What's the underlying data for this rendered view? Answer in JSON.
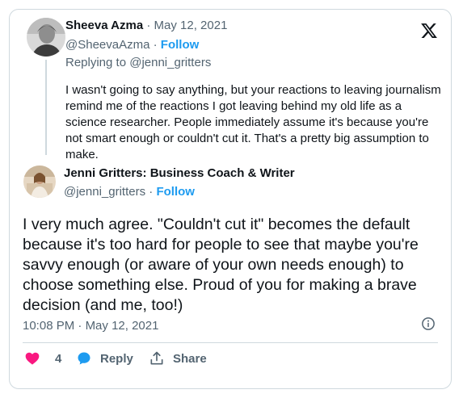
{
  "tweet1": {
    "author_name": "Sheeva Azma",
    "date_sep": " · ",
    "date": "May 12, 2021",
    "handle": "@SheevaAzma",
    "handle_sep": " · ",
    "follow_label": "Follow",
    "replying_to": "Replying to @jenni_gritters",
    "text": "I wasn't going to say anything, but your reactions to leaving journalism remind me of the reactions I got leaving behind my old life as a science researcher. People immediately assume it's because you're not smart enough or couldn't cut it. That's a pretty big assumption to make."
  },
  "tweet2": {
    "author_name": "Jenni Gritters: Business Coach & Writer",
    "handle": "@jenni_gritters",
    "handle_sep": " · ",
    "follow_label": "Follow",
    "text": "I very much agree. \"Couldn't cut it\" becomes the default because it's too hard for people to see that maybe you're savvy enough (or aware of your own needs enough) to choose something else. Proud of you for making a brave decision (and me, too!)",
    "time": "10:08 PM",
    "time_sep": " · ",
    "date": "May 12, 2021"
  },
  "actions": {
    "like_count": "4",
    "reply_label": "Reply",
    "share_label": "Share"
  },
  "colors": {
    "accent": "#1d9bf0",
    "like": "#f91880",
    "muted": "#536471",
    "border": "#cfd9de"
  },
  "icons": [
    "x-logo-icon",
    "info-icon",
    "heart-icon",
    "speech-bubble-icon",
    "share-icon"
  ]
}
